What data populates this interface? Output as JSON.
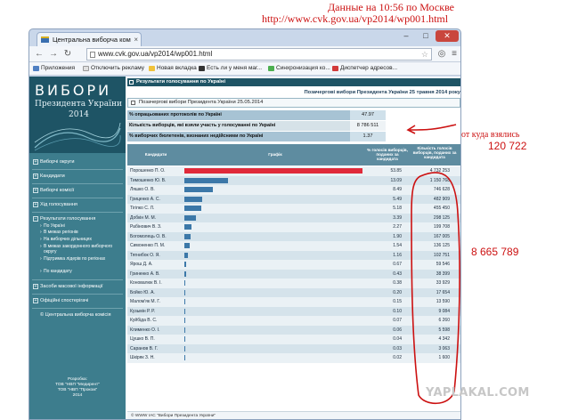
{
  "top_notes": {
    "line1": "Данные на 10:56 по Москве",
    "line2": "http://www.cvk.gov.ua/vp2014/wp001.html"
  },
  "browser": {
    "tab_title": "Центральна виборча ком",
    "url": "www.cvk.gov.ua/vp2014/wp001.html",
    "bookmarks": [
      {
        "label": "Приложения",
        "color": "#4f7fc2"
      },
      {
        "label": "Отключить рекламу",
        "color": "#e0e0e0"
      },
      {
        "label": "Новая вкладка",
        "color": "#f0c23a"
      },
      {
        "label": "Есть ли у меня маг...",
        "color": "#333333"
      },
      {
        "label": "Синхронизация ко...",
        "color": "#4caf50"
      },
      {
        "label": "Диспетчер адресов...",
        "color": "#d23a3a"
      }
    ]
  },
  "sidebar": {
    "banner_title": "ВИБОРИ",
    "banner_subtitle": "Президента України",
    "banner_year": "2014",
    "items": [
      {
        "label": "Виборчі округи"
      },
      {
        "label": "Кандидати"
      },
      {
        "label": "Виборчі комісії"
      },
      {
        "label": "Хід голосування"
      },
      {
        "label": "Результати голосування"
      }
    ],
    "subitems": [
      {
        "label": "По Україні"
      },
      {
        "label": "В межах регіонів"
      },
      {
        "label": "На виборчих дільницях"
      },
      {
        "label": "В межах закордонного виборчого округу"
      },
      {
        "label": "Підтримка лідерів по регіонах"
      },
      {
        "label": "По кандидату"
      }
    ],
    "items_bottom": [
      {
        "label": "Засоби масової інформації"
      },
      {
        "label": "Офіційні спостерігачі"
      },
      {
        "label": "© Центральна виборча комісія"
      }
    ],
    "credits": [
      "Розробка:",
      "ТОВ \"НВП \"Медирент\"",
      "ТОВ \"НВП \"Проком\"",
      "2014"
    ]
  },
  "content": {
    "header": "Результати голосування по Україні",
    "title": "Позачергові вибори Президента України 25 травня 2014 року",
    "select_label": "Позачергові вибори Президента України 25.05.2014",
    "stats": [
      {
        "label": "% опрацьованих протоколів по Україні",
        "value": "47.97"
      },
      {
        "label": "Кількість виборців, які взяли участь у голосуванні по Україні",
        "value": "8 786 511"
      },
      {
        "label": "% виборчих бюлетенів, визнаних недійсними по Україні",
        "value": "1.37"
      }
    ],
    "table_headers": {
      "candidate": "Кандидати",
      "chart": "Графік",
      "pct": "% голосів виборців, поданих за кандидата",
      "count": "Кількість голосів виборців, поданих за кандидата"
    },
    "footer": "© WWW ІАС \"Вибори Президента України\""
  },
  "chart_data": {
    "type": "bar",
    "categories": [
      "Порошенко П. О.",
      "Тимошенко Ю. В.",
      "Ляшко О. В.",
      "Гриценко А. С.",
      "Тігіпко С. Л.",
      "Добкін М. М.",
      "Рабінович В. З.",
      "Богомолець О. В.",
      "Симоненко П. М.",
      "Тягнибок О. Я.",
      "Ярош Д. А.",
      "Гриненко А. В.",
      "Коновалюк В. І.",
      "Бойко Ю. А.",
      "Малом'як М. Г.",
      "Кузьмін Р. Р.",
      "Куйбіда В. С.",
      "Клименко О. І.",
      "Цушко В. П.",
      "Саранов В. Г.",
      "Шкіряк З. Н."
    ],
    "percentages": [
      "53.85",
      "13.09",
      "8.49",
      "5.49",
      "5.18",
      "3.39",
      "2.27",
      "1.90",
      "1.54",
      "1.16",
      "0.67",
      "0.43",
      "0.38",
      "0.20",
      "0.15",
      "0.10",
      "0.07",
      "0.06",
      "0.04",
      "0.03",
      "0.02"
    ],
    "votes": [
      "4 732 253",
      "1 150 768",
      "746 628",
      "482 909",
      "455 450",
      "298 125",
      "199 708",
      "167 005",
      "136 125",
      "102 751",
      "59 546",
      "38 399",
      "33 929",
      "17 654",
      "13 590",
      "9 084",
      "6 260",
      "5 598",
      "4 342",
      "3 063",
      "1 600"
    ],
    "values": [
      53.85,
      13.09,
      8.49,
      5.49,
      5.18,
      3.39,
      2.27,
      1.9,
      1.54,
      1.16,
      0.67,
      0.43,
      0.38,
      0.2,
      0.15,
      0.1,
      0.07,
      0.06,
      0.04,
      0.03,
      0.02
    ],
    "ylim": [
      0,
      53.85
    ],
    "colors": {
      "leader": "#e02a3a",
      "others": "#3c78a8"
    }
  },
  "annotations": {
    "question": "от куда взялись",
    "number1": "120 722",
    "number2": "8 665 789",
    "color": "#cc1111"
  },
  "watermark": "YAPLAKAL.COM"
}
